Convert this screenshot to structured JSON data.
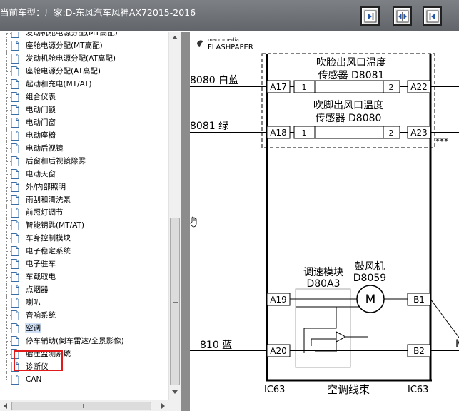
{
  "header": {
    "title": "当前车型：厂家:D-东风汽车风神AX72015-2016",
    "buttons": [
      {
        "name": "collapse-left-button",
        "icon": "panel-expand-icon"
      },
      {
        "name": "split-view-button",
        "icon": "panel-split-icon"
      },
      {
        "name": "collapse-right-button",
        "icon": "panel-collapse-icon"
      }
    ]
  },
  "tree": {
    "items": [
      {
        "label": "发动机舱电源分配(MT高配)"
      },
      {
        "label": "座舱电源分配(MT高配)"
      },
      {
        "label": "发动机舱电源分配(AT高配)"
      },
      {
        "label": "座舱电源分配(AT高配)"
      },
      {
        "label": "起动和充电(MT/AT)"
      },
      {
        "label": "组合仪表"
      },
      {
        "label": "电动门锁"
      },
      {
        "label": "电动门窗"
      },
      {
        "label": "电动座椅"
      },
      {
        "label": "电动后视镜"
      },
      {
        "label": "后窗和后视镜除雾"
      },
      {
        "label": "电动天窗"
      },
      {
        "label": "外/内部照明"
      },
      {
        "label": "雨刮和清洗泵"
      },
      {
        "label": "前照灯调节"
      },
      {
        "label": "智能钥匙(MT/AT)"
      },
      {
        "label": "车身控制模块"
      },
      {
        "label": "电子稳定系统"
      },
      {
        "label": "电子驻车"
      },
      {
        "label": "车载取电"
      },
      {
        "label": "点烟器"
      },
      {
        "label": "喇叭"
      },
      {
        "label": "音响系统"
      },
      {
        "label": "空调",
        "selected": true
      },
      {
        "label": "停车辅助(倒车雷达/全景影像)"
      },
      {
        "label": "胎压监测系统"
      },
      {
        "label": "诊断仪"
      },
      {
        "label": "CAN"
      }
    ]
  },
  "viewer": {
    "logo_small": "macromedia",
    "logo_big": "FLASHPAPER",
    "schematic": {
      "sensor1_line1": "吹脸出风口温度",
      "sensor1_line2": "传感器 D8081",
      "sensor2_line1": "吹脚出风口温度",
      "sensor2_line2": "传感器 D8080",
      "wire1": "8080 白蓝",
      "wire2": "8081 绿",
      "wire3": "810 蓝",
      "pin_a17": "A17",
      "pin_a18": "A18",
      "pin_a19": "A19",
      "pin_a20": "A20",
      "pin_a22": "A22",
      "pin_a23": "A23",
      "pin_b1": "B1",
      "pin_b2": "B2",
      "pin1a": "1",
      "pin2a": "2",
      "pin1b": "1",
      "pin2b": "2",
      "module_line1": "调速模块",
      "module_line2": "D80A3",
      "blower_line1": "鼓风机",
      "blower_line2": "D8059",
      "motor_symbol": "M",
      "motor_symbol2": "M",
      "stars": "***",
      "conn_left": "IC63",
      "conn_right": "IC63",
      "harness": "空调线束"
    }
  }
}
